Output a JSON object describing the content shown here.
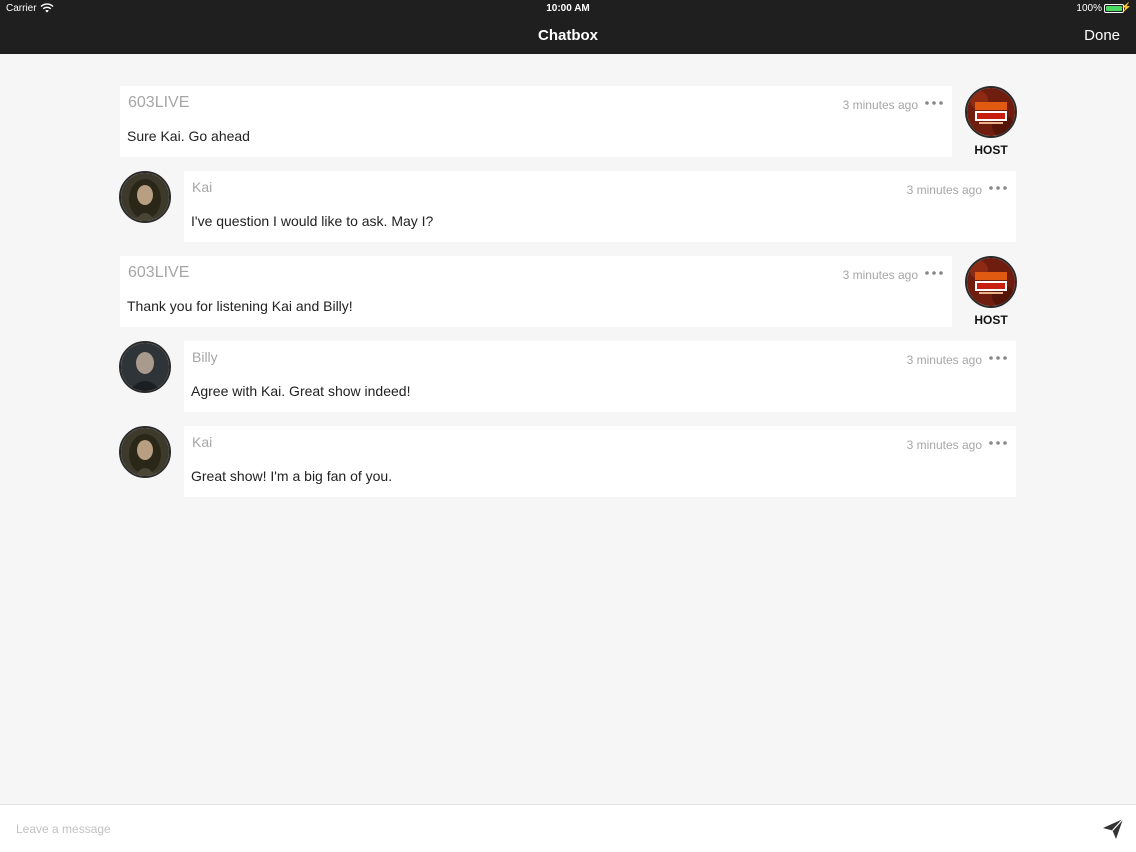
{
  "status_bar": {
    "carrier": "Carrier",
    "time": "10:00 AM",
    "battery": "100%"
  },
  "nav": {
    "title": "Chatbox",
    "done_label": "Done"
  },
  "host_badge": "HOST",
  "messages": [
    {
      "type": "host",
      "author": "603LIVE",
      "time": "3 minutes ago",
      "text": "Sure Kai. Go ahead"
    },
    {
      "type": "user",
      "author": "Kai",
      "time": "3 minutes ago",
      "text": "I've question I would like to ask. May I?"
    },
    {
      "type": "host",
      "author": "603LIVE",
      "time": "3 minutes ago",
      "text": "Thank you for listening Kai and Billy!"
    },
    {
      "type": "user",
      "author": "Billy",
      "time": "3 minutes ago",
      "text": "Agree with Kai. Great show indeed!"
    },
    {
      "type": "user",
      "author": "Kai",
      "time": "3 minutes ago",
      "text": "Great show! I'm a big fan of you."
    }
  ],
  "composer": {
    "placeholder": "Leave a message"
  },
  "colors": {
    "bar": "#1f1f1f",
    "battery": "#4cd964",
    "background": "#f6f6f7",
    "meta_text": "#a6a6a6"
  },
  "icons": [
    "wifi-icon",
    "battery-icon",
    "more-options-icon",
    "send-icon"
  ]
}
